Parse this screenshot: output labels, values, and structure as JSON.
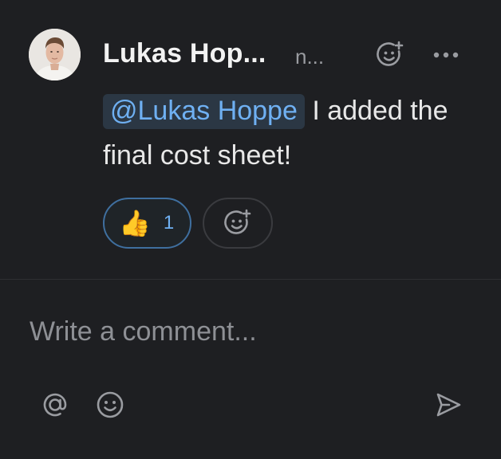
{
  "comment": {
    "author": "Lukas Hop...",
    "timestamp": "n...",
    "mention": "@Lukas Hoppe",
    "text": " I added the final cost sheet!",
    "reactions": [
      {
        "emoji": "👍",
        "emoji_name": "thumbs-up",
        "count": "1",
        "reacted_by_me": true
      }
    ]
  },
  "composer": {
    "placeholder": "Write a comment...",
    "value": ""
  },
  "icons": {
    "add_reaction": "smiley-plus-icon",
    "more": "more-horizontal-icon",
    "mention": "at-sign-icon",
    "emoji": "smiley-icon",
    "send": "send-icon"
  },
  "colors": {
    "background": "#1e1f22",
    "mention_text": "#6fb0f2",
    "mention_bg": "#2b3744",
    "reaction_border": "#3f6f9f",
    "icon": "#9a9ca1"
  }
}
